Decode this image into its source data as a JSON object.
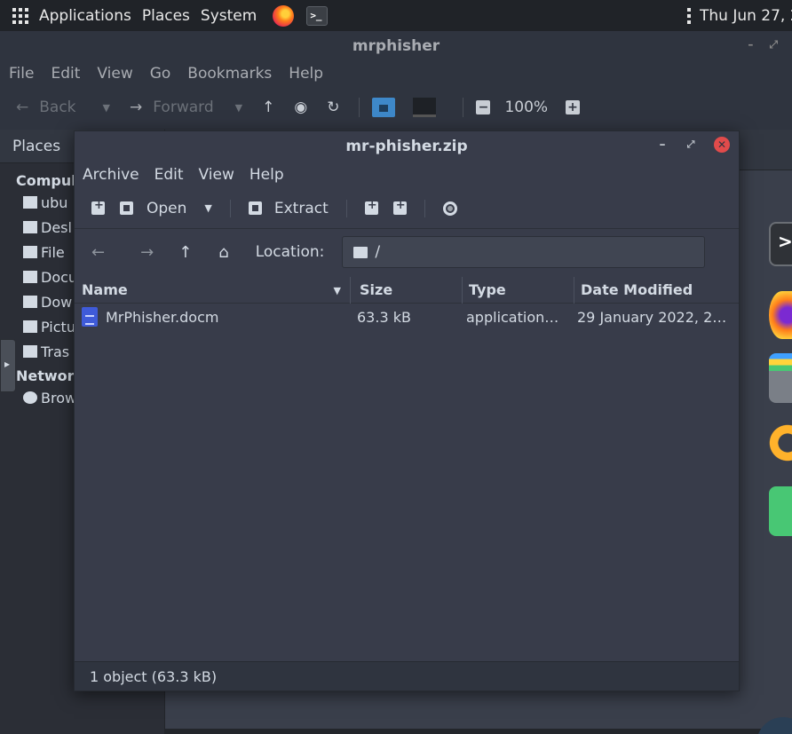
{
  "top_panel": {
    "applications": "Applications",
    "places": "Places",
    "system": "System",
    "clock": "Thu Jun 27, 2"
  },
  "file_manager": {
    "title": "mrphisher",
    "menu": [
      "File",
      "Edit",
      "View",
      "Go",
      "Bookmarks",
      "Help"
    ],
    "toolbar": {
      "back": "Back",
      "forward": "Forward",
      "zoom": "100%"
    },
    "sidebar_header": "Places",
    "sidebar_computer": "Compul",
    "sidebar_items": [
      "ubu",
      "Desl",
      "File",
      "Docu",
      "Dow",
      "Pictu",
      "Tras"
    ],
    "sidebar_network": "Networ",
    "sidebar_browse": "Brow"
  },
  "archive": {
    "title": "mr-phisher.zip",
    "menu": [
      "Archive",
      "Edit",
      "View",
      "Help"
    ],
    "toolbar": {
      "open": "Open",
      "extract": "Extract"
    },
    "location_label": "Location:",
    "location_value": "/",
    "columns": {
      "name": "Name",
      "size": "Size",
      "type": "Type",
      "date": "Date Modified"
    },
    "rows": [
      {
        "name": "MrPhisher.docm",
        "size": "63.3 kB",
        "type": "application…",
        "date": "29 January 2022, 2…"
      }
    ],
    "status": "1 object (63.3 kB)"
  },
  "icons": {
    "apps": "grid-icon",
    "firefox": "firefox-icon",
    "terminal": "terminal-icon",
    "close": "close-icon",
    "document": "document-icon",
    "folder": "folder-icon"
  },
  "colors": {
    "close_button": "#e14b4b",
    "doc_icon": "#3f5bd9",
    "accent_folder": "#3e88c9"
  }
}
